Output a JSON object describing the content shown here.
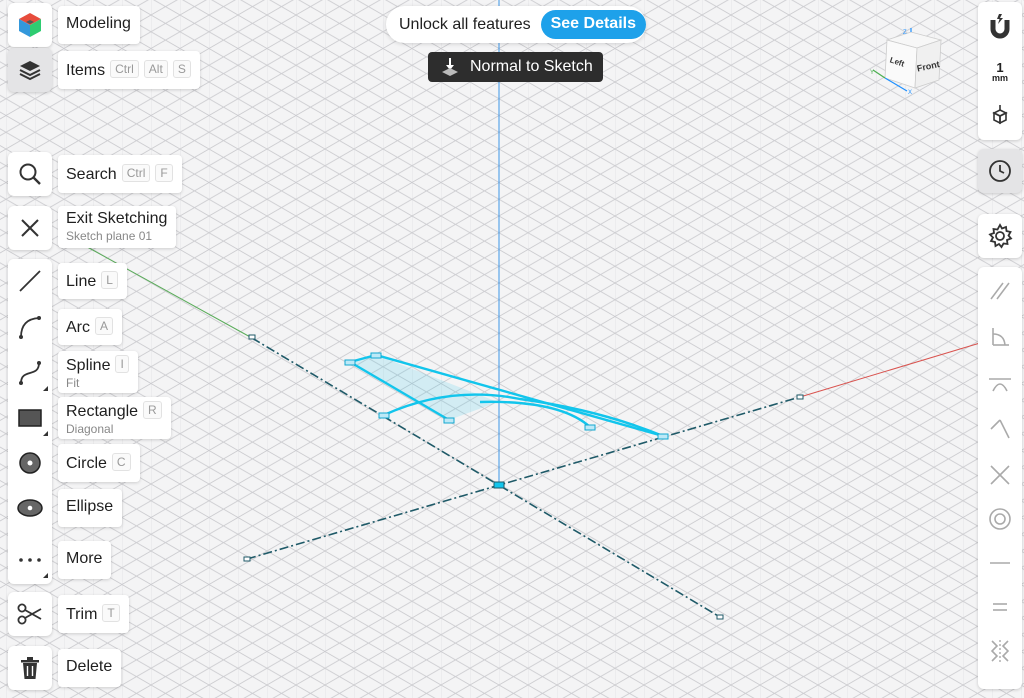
{
  "top_left": {
    "modeling_label": "Modeling",
    "items_label": "Items",
    "items_keys": [
      "Ctrl",
      "Alt",
      "S"
    ]
  },
  "banner": {
    "text": "Unlock all features",
    "button": "See Details"
  },
  "tooltip": {
    "text": "Normal to Sketch"
  },
  "view_cube": {
    "left": "Left",
    "front": "Front",
    "axis_x": "X",
    "axis_y": "Y",
    "axis_z": "Z"
  },
  "unit": {
    "value": "1",
    "unit": "mm"
  },
  "tools": {
    "search": {
      "label": "Search",
      "keys": [
        "Ctrl",
        "F"
      ]
    },
    "exit": {
      "label": "Exit Sketching",
      "sub": "Sketch plane 01"
    },
    "line": {
      "label": "Line",
      "key": "L"
    },
    "arc": {
      "label": "Arc",
      "key": "A"
    },
    "spline": {
      "label": "Spline",
      "key": "I",
      "sub": "Fit"
    },
    "rectangle": {
      "label": "Rectangle",
      "key": "R",
      "sub": "Diagonal"
    },
    "circle": {
      "label": "Circle",
      "key": "C"
    },
    "ellipse": {
      "label": "Ellipse"
    },
    "more": {
      "label": "More"
    },
    "trim": {
      "label": "Trim",
      "key": "T"
    },
    "delete": {
      "label": "Delete"
    }
  },
  "colors": {
    "accent": "#1ea1ea",
    "sketch": "#12c5ec",
    "axis_x": "#d9534f",
    "axis_y": "#4caf50",
    "axis_z": "#1e90ff",
    "axis_dash": "#1f5a68",
    "grid": "#c9c9cd"
  },
  "constraint_icons": [
    "parallel-icon",
    "tangent-icon",
    "horizontal-vertical-icon",
    "perpendicular-icon",
    "intersect-icon",
    "concentric-icon",
    "horizontal-icon",
    "equal-icon",
    "symmetric-icon"
  ]
}
